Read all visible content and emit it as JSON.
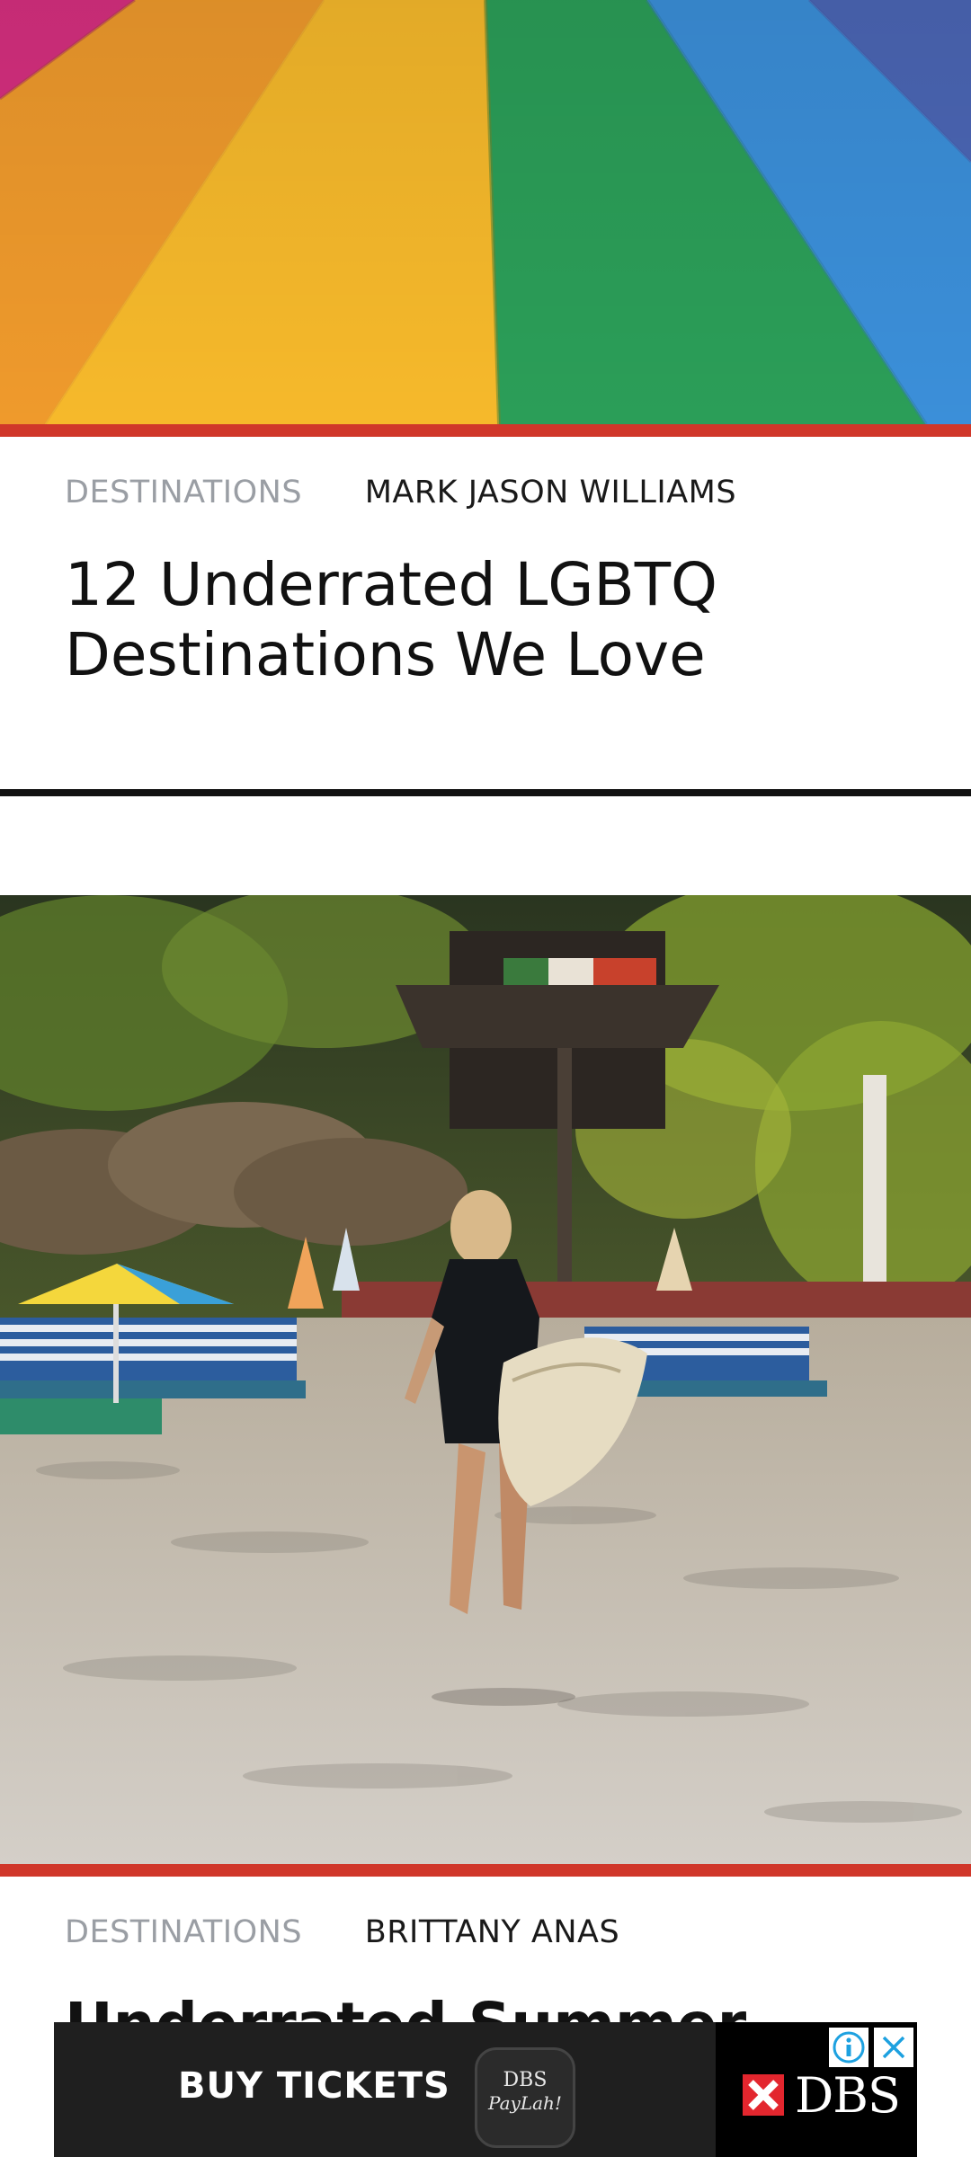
{
  "colors": {
    "accent": "#d0372a",
    "divider": "#111111",
    "category_text": "#9a9ea4",
    "author_text": "#1a1a1a",
    "title_text": "#111111",
    "ad_icon": "#1da1e0"
  },
  "articles": [
    {
      "image_description_icon": "rainbow-road-image",
      "category": "DESTINATIONS",
      "author": "MARK JASON WILLIAMS",
      "title_line1": "12 Underrated LGBTQ",
      "title_line2": "Destinations We Love"
    },
    {
      "image_description_icon": "beach-surfer-image",
      "category": "DESTINATIONS",
      "author": "BRITTANY ANAS",
      "title_partial": "Underrated Summer"
    }
  ],
  "ad": {
    "cta": "BUY TICKETS",
    "paylah_top": "DBS",
    "paylah_bottom": "PayLah!",
    "brand": "DBS",
    "info_icon": "info-icon",
    "close_icon": "close-icon"
  }
}
